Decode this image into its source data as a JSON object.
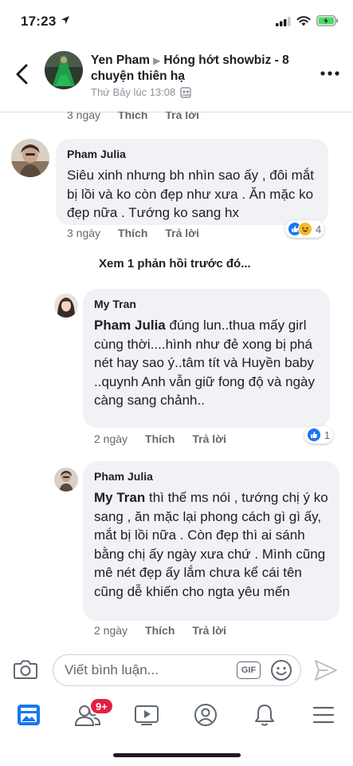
{
  "status_bar": {
    "time": "17:23"
  },
  "header": {
    "author": "Yen Pham",
    "group": "Hóng hớt showbiz - 8 chuyện thiên hạ",
    "timestamp": "Thứ Bảy lúc 13:08"
  },
  "top_meta": {
    "time": "3 ngày",
    "like": "Thích",
    "reply": "Trả lời"
  },
  "comments": [
    {
      "author": "Pham Julia",
      "text": "Siêu xinh nhưng bh nhìn sao ấy , đôi mắt bị lồi và ko còn đẹp như xưa . Ăn mặc ko đẹp nữa . Tướng ko sang hx",
      "time": "3 ngày",
      "like": "Thích",
      "reply": "Trả lời",
      "reaction_count": "4"
    }
  ],
  "view_previous": "Xem 1 phản hồi trước đó...",
  "replies": [
    {
      "author": "My Tran",
      "mention": "Pham Julia",
      "text": " đúng lun..thua mấy girl cùng thời....hình như đẻ xong bị phá nét hay sao ý..tâm tít và Huyền baby ..quynh Anh vẫn giữ fong độ và ngày càng sang chảnh..",
      "time": "2 ngày",
      "like": "Thích",
      "reply": "Trả lời",
      "reaction_count": "1"
    },
    {
      "author": "Pham Julia",
      "mention": "My Tran",
      "text": "  thì thế ms nói , tướng chị ý ko sang , ăn mặc lại phong cách gì gì ấy, mắt bị lồi nữa . Còn đẹp thì ai sánh bằng chị ấy ngày xưa chứ . Mình cũng mê nét đẹp ấy lắm chưa kể cái tên cũng dễ khiến cho ngta yêu mến",
      "time": "2 ngày",
      "like": "Thích",
      "reply": "Trả lời"
    }
  ],
  "input": {
    "placeholder": "Viết bình luận...",
    "gif_label": "GIF"
  },
  "tab_bar": {
    "friends_badge": "9+"
  },
  "colors": {
    "accent": "#1877f2",
    "badge": "#e41e3f",
    "bubble": "#f0f2f5"
  }
}
